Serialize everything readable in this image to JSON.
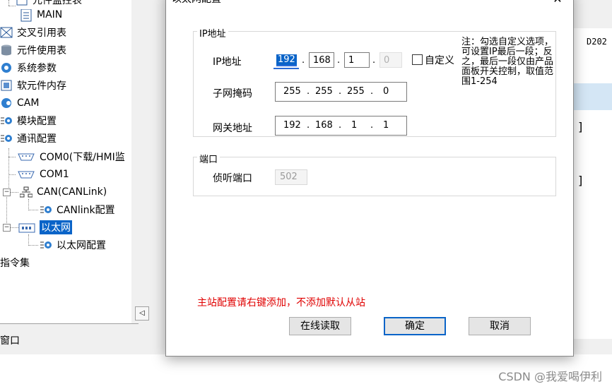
{
  "tree": {
    "items": [
      {
        "label": "元件监控表",
        "icon": "monitor-table-icon"
      },
      {
        "label": "MAIN",
        "icon": "document-icon"
      },
      {
        "label": "交叉引用表",
        "icon": "cross-ref-icon"
      },
      {
        "label": "元件使用表",
        "icon": "database-icon"
      },
      {
        "label": "系统参数",
        "icon": "system-params-icon"
      },
      {
        "label": "软元件内存",
        "icon": "memory-icon"
      },
      {
        "label": "CAM",
        "icon": "cam-icon"
      },
      {
        "label": "模块配置",
        "icon": "config-gear-icon"
      },
      {
        "label": "通讯配置",
        "icon": "config-gear-icon"
      },
      {
        "label": "COM0(下载/HMI监",
        "icon": "serial-port-icon"
      },
      {
        "label": "COM1",
        "icon": "serial-port-icon"
      },
      {
        "label": "CAN(CANLink)",
        "icon": "network-tree-icon"
      },
      {
        "label": "CANlink配置",
        "icon": "config-gear-icon"
      },
      {
        "label": "以太网",
        "icon": "ethernet-icon"
      },
      {
        "label": "以太网配置",
        "icon": "config-gear-icon"
      },
      {
        "label": "指令集",
        "icon": ""
      }
    ],
    "expander_minus": "−"
  },
  "bottom_left": {
    "label": "窗口"
  },
  "scroll_left_arrow": "◁",
  "right_panel": {
    "device_label": "D202",
    "bracket1": "]",
    "bracket2": "]"
  },
  "dialog": {
    "title": "以太网配置",
    "close_symbol": "✕",
    "ip_group": {
      "title": "IP地址",
      "ip_label": "IP地址",
      "ip_segments": [
        "192",
        "168",
        "1",
        "0"
      ],
      "custom_label": "自定义",
      "custom_checked": false,
      "subnet_label": "子网掩码",
      "subnet_segments": [
        "255",
        "255",
        "255",
        "0"
      ],
      "gateway_label": "网关地址",
      "gateway_segments": [
        "192",
        "168",
        "1",
        "1"
      ],
      "dot": "."
    },
    "note": "注：勾选自定义选项，可设置IP最后一段；反之，最后一段仅由产品面板开关控制，取值范围1-254",
    "port_group": {
      "title": "端口",
      "listen_label": "侦听端口",
      "listen_value": "502"
    },
    "warning": "主站配置请右键添加，不添加默认从站",
    "buttons": {
      "online_read": "在线读取",
      "ok": "确定",
      "cancel": "取消"
    }
  },
  "watermark": "CSDN @我爱喝伊利"
}
